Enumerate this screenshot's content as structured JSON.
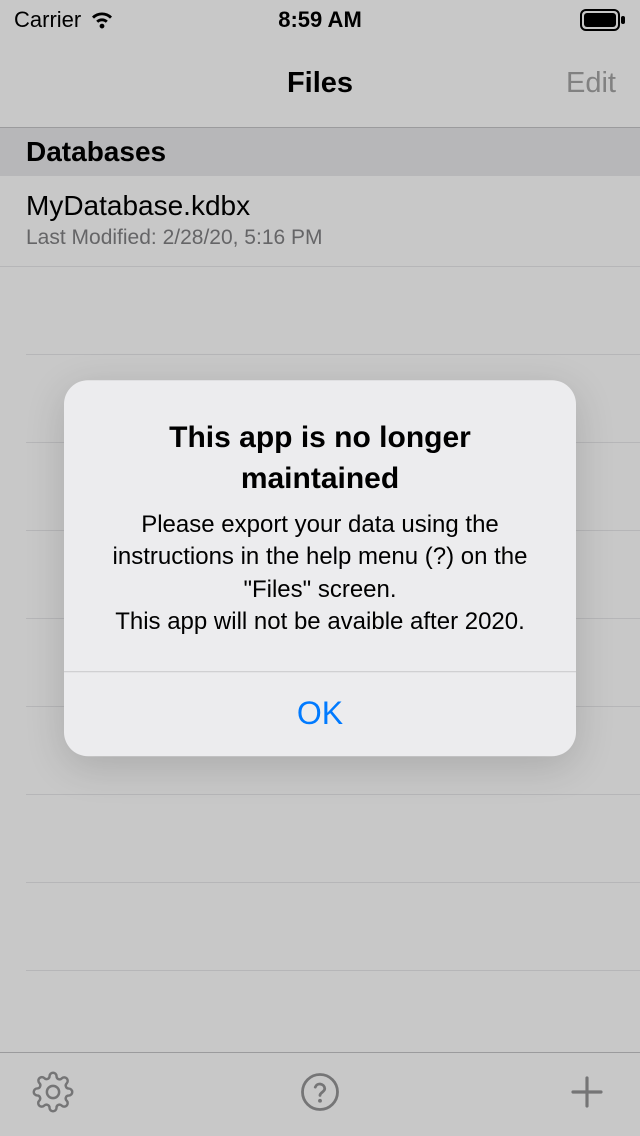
{
  "status_bar": {
    "carrier": "Carrier",
    "time": "8:59 AM"
  },
  "nav": {
    "title": "Files",
    "edit": "Edit"
  },
  "section": {
    "header": "Databases"
  },
  "items": [
    {
      "title": "MyDatabase.kdbx",
      "subtitle": "Last Modified: 2/28/20, 5:16 PM"
    }
  ],
  "alert": {
    "title": "This app is no longer maintained",
    "message": "Please export your data using the instructions in the help menu (?) on the \"Files\" screen.\nThis app will not be avaible after 2020.",
    "ok": "OK"
  }
}
